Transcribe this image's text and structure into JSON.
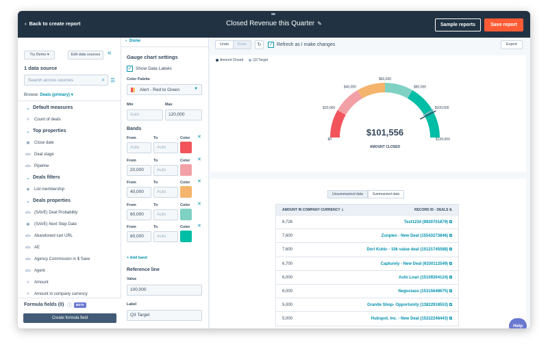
{
  "header": {
    "back_label": "Back to create report",
    "title": "Closed Revenue this Quarter",
    "sample_label": "Sample reports",
    "save_label": "Save report"
  },
  "left": {
    "try_demo": "Try Demo",
    "edit_sources": "Edit data sources",
    "heading": "1 data source",
    "search_placeholder": "Search across sources",
    "browse_label": "Browse:",
    "browse_value": "Deals (primary)",
    "tree": [
      {
        "type": "group",
        "label": "Default measures"
      },
      {
        "type": "item",
        "glyph": "#",
        "label": "Count of deals"
      },
      {
        "type": "group",
        "label": "Top properties"
      },
      {
        "type": "item",
        "glyph": "▣",
        "label": "Close date"
      },
      {
        "type": "item",
        "glyph": "abc",
        "label": "Deal stage"
      },
      {
        "type": "item",
        "glyph": "abc",
        "label": "Pipeline"
      },
      {
        "type": "group",
        "label": "Deals filters"
      },
      {
        "type": "item",
        "glyph": "◉",
        "label": "List membership"
      },
      {
        "type": "group",
        "label": "Deals properties"
      },
      {
        "type": "item",
        "glyph": "abc",
        "label": "(SAVE) Deal Probability"
      },
      {
        "type": "item",
        "glyph": "▣",
        "label": "(SAVE) Next Step Date"
      },
      {
        "type": "item",
        "glyph": "abc",
        "label": "Abandoned cart URL"
      },
      {
        "type": "item",
        "glyph": "abc",
        "label": "AE"
      },
      {
        "type": "item",
        "glyph": "abc",
        "label": "Agency Commission in $ Save"
      },
      {
        "type": "item",
        "glyph": "abc",
        "label": "Agent"
      },
      {
        "type": "item",
        "glyph": "#",
        "label": "Amount"
      },
      {
        "type": "item",
        "glyph": "#",
        "label": "Amount in company currency"
      }
    ],
    "formula_title": "Formula fields (0)",
    "beta": "BETA",
    "create_formula": "Create formula field"
  },
  "settings": {
    "done": "Done",
    "gauge_heading": "Gauge chart settings",
    "show_labels": "Show Data Labels",
    "palette_label": "Color Palette",
    "palette_value": "Alert - Red to Green",
    "min_label": "Min",
    "max_label": "Max",
    "min_placeholder": "Auto",
    "max_value": "120,000",
    "bands_heading": "Bands",
    "from_label": "From",
    "to_label": "To",
    "color_label": "Color",
    "bands": [
      {
        "from": "Auto",
        "to": "Auto",
        "color": "#f2545b"
      },
      {
        "from": "20,000",
        "to": "Auto",
        "color": "#f2a0a6"
      },
      {
        "from": "40,000",
        "to": "Auto",
        "color": "#f5b46b"
      },
      {
        "from": "60,000",
        "to": "Auto",
        "color": "#7fd1c4"
      },
      {
        "from": "80,000",
        "to": "Auto",
        "color": "#00bda5"
      }
    ],
    "add_band": "+ Add band",
    "ref_heading": "Reference line",
    "value_label": "Value",
    "ref_value": "100,000",
    "ref_label_label": "Label",
    "ref_label_value": "Q3 Target"
  },
  "toolbar": {
    "undo": "Undo",
    "redo": "Redo",
    "refresh_label": "Refresh as I make changes",
    "export": "Export"
  },
  "chart_data": {
    "type": "gauge",
    "legend": [
      {
        "name": "Amount Closed",
        "color": "#33475b"
      },
      {
        "name": "Q3 Target",
        "color": "#99afc4"
      }
    ],
    "min": 0,
    "max": 120000,
    "value": 101556,
    "value_label": "$101,556",
    "value_caption": "AMOUNT CLOSED",
    "reference": 100000,
    "tick_labels": [
      "$0",
      "$20,000",
      "$40,000",
      "$60,000",
      "$80,000",
      "$100,000",
      "$120,000"
    ],
    "ticks": [
      0,
      20000,
      40000,
      60000,
      80000,
      100000,
      120000
    ],
    "bands": [
      {
        "from": 0,
        "to": 20000,
        "color": "#f2545b"
      },
      {
        "from": 20000,
        "to": 40000,
        "color": "#f2a0a6"
      },
      {
        "from": 40000,
        "to": 60000,
        "color": "#f5b46b"
      },
      {
        "from": 60000,
        "to": 80000,
        "color": "#7fd1c4"
      },
      {
        "from": 80000,
        "to": 120000,
        "color": "#00bda5"
      }
    ]
  },
  "table": {
    "tab_unsummarized": "Unsummarized data",
    "tab_summarized": "Summarized data",
    "col_amount": "AMOUNT IN COMPANY CURRENCY",
    "col_record": "RECORD ID - DEALS",
    "rows": [
      {
        "amount": "8,726",
        "record": "Test1234 (9920701879)"
      },
      {
        "amount": "7,600",
        "record": "Zunplex - New Deal (15543273846)"
      },
      {
        "amount": "7,600",
        "record": "Dori Kuhic - 10k value deal (15121745588)"
      },
      {
        "amount": "6,700",
        "record": "Capturely - New Deal (6330112549)"
      },
      {
        "amount": "6,000",
        "record": "Auto Loan (15109304124)"
      },
      {
        "amount": "6,000",
        "record": "Negociaos (15315648675)"
      },
      {
        "amount": "5,000",
        "record": "Granite Shop- Opportunity (13822918553)"
      },
      {
        "amount": "5,000",
        "record": "Hubspot, Inc. - New Deal (15222248443)"
      }
    ]
  },
  "help": "Help"
}
